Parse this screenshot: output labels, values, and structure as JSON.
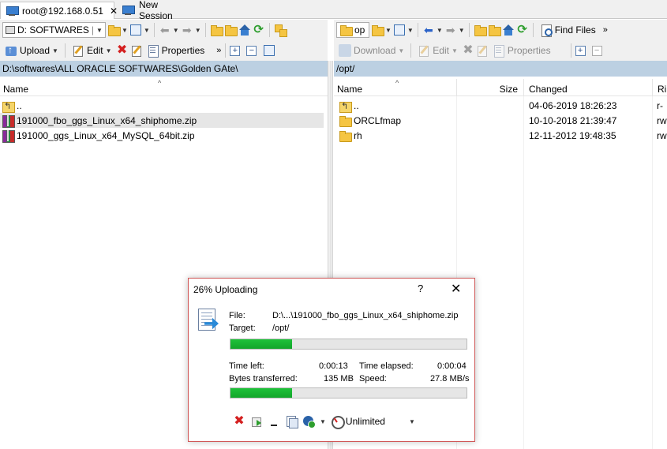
{
  "tabs": [
    {
      "label": "root@192.168.0.51",
      "close": "✕"
    },
    {
      "label": "New Session"
    }
  ],
  "left_toolbar1": {
    "drive_label": "D: SOFTWARES"
  },
  "left_toolbar2": {
    "upload": "Upload",
    "edit": "Edit",
    "properties": "Properties"
  },
  "right_toolbar1": {
    "dir_label": "op",
    "find_files": "Find Files"
  },
  "right_toolbar2": {
    "download": "Download",
    "edit": "Edit",
    "properties": "Properties"
  },
  "left_pane": {
    "path": "D:\\softwares\\ALL ORACLE SOFTWARES\\Golden GAte\\",
    "columns": {
      "name": "Name"
    },
    "rows": [
      {
        "name": ".."
      },
      {
        "name": "191000_fbo_ggs_Linux_x64_shiphome.zip"
      },
      {
        "name": "191000_ggs_Linux_x64_MySQL_64bit.zip"
      }
    ]
  },
  "right_pane": {
    "path": "/opt/",
    "columns": {
      "name": "Name",
      "size": "Size",
      "changed": "Changed",
      "rights": "Ri"
    },
    "rows": [
      {
        "name": "..",
        "size": "",
        "changed": "04-06-2019 18:26:23",
        "rights": "r-"
      },
      {
        "name": "ORCLfmap",
        "size": "",
        "changed": "10-10-2018 21:39:47",
        "rights": "rw"
      },
      {
        "name": "rh",
        "size": "",
        "changed": "12-11-2012 19:48:35",
        "rights": "rw"
      }
    ]
  },
  "dialog": {
    "title": "26% Uploading",
    "help": "?",
    "close": "✕",
    "file_label": "File:",
    "file_value": "D:\\...\\191000_fbo_ggs_Linux_x64_shiphome.zip",
    "target_label": "Target:",
    "target_value": "/opt/",
    "file_progress": 0.26,
    "time_left_label": "Time left:",
    "time_left": "0:00:13",
    "time_elapsed_label": "Time elapsed:",
    "time_elapsed": "0:00:04",
    "bytes_label": "Bytes transferred:",
    "bytes_value": "135 MB",
    "speed_label": "Speed:",
    "speed_value": "27.8 MB/s",
    "total_progress": 0.26,
    "speed_limit": "Unlimited"
  },
  "colors": {
    "accent": "#bcd0e2",
    "progress": "#13a52b",
    "dialog_border": "#d05858"
  }
}
